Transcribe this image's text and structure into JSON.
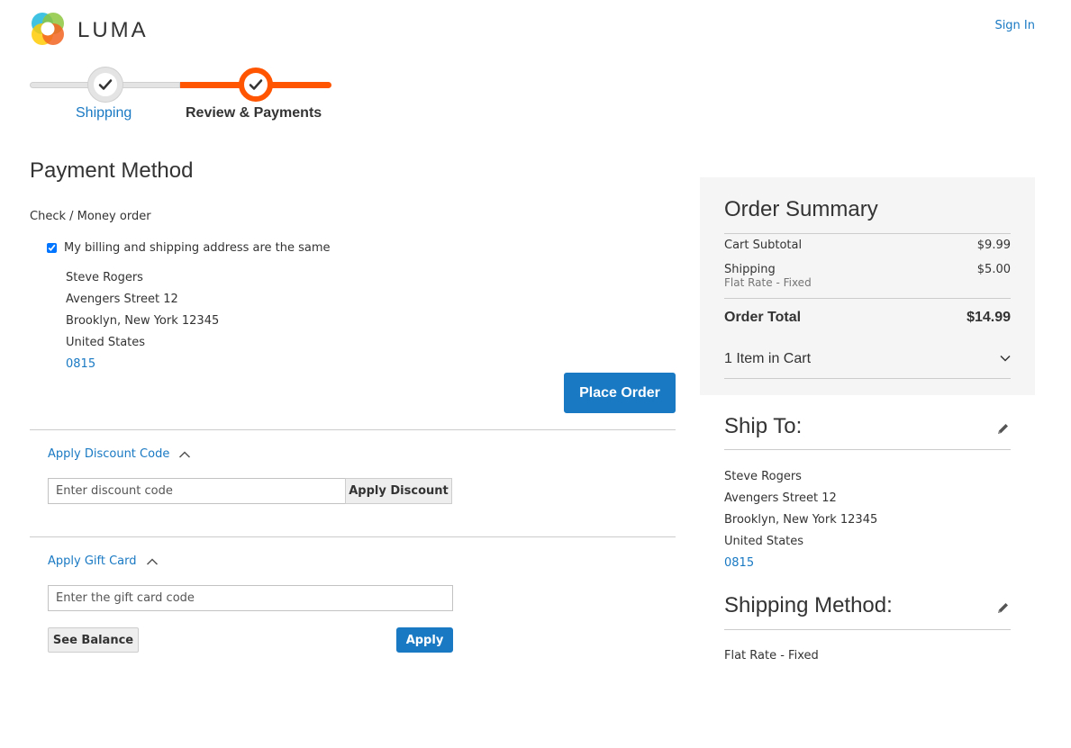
{
  "header": {
    "logo_text": "LUMA",
    "sign_in": "Sign In"
  },
  "progress": {
    "steps": [
      {
        "label": "Shipping",
        "state": "complete"
      },
      {
        "label": "Review & Payments",
        "state": "active"
      }
    ]
  },
  "payment": {
    "title": "Payment Method",
    "method": "Check / Money order",
    "same_address_label": "My billing and shipping address are the same",
    "same_address_checked": true,
    "address": {
      "name": "Steve Rogers",
      "street": "Avengers Street 12",
      "city": "Brooklyn, New York 12345",
      "country": "United States",
      "phone": "0815"
    },
    "place_order": "Place Order"
  },
  "discount": {
    "toggle_label": "Apply Discount Code",
    "placeholder": "Enter discount code",
    "button": "Apply Discount"
  },
  "gift_card": {
    "toggle_label": "Apply Gift Card",
    "placeholder": "Enter the gift card code",
    "see_balance": "See Balance",
    "apply": "Apply"
  },
  "summary": {
    "title": "Order Summary",
    "subtotal_label": "Cart Subtotal",
    "subtotal_value": "$9.99",
    "shipping_label": "Shipping",
    "shipping_value": "$5.00",
    "shipping_method": "Flat Rate - Fixed",
    "total_label": "Order Total",
    "total_value": "$14.99",
    "items_in_cart": "1 Item in Cart"
  },
  "ship_to": {
    "title": "Ship To:",
    "name": "Steve Rogers",
    "street": "Avengers Street 12",
    "city": "Brooklyn, New York 12345",
    "country": "United States",
    "phone": "0815"
  },
  "shipping_method": {
    "title": "Shipping Method:",
    "value": "Flat Rate - Fixed"
  },
  "colors": {
    "accent_blue": "#1979c3",
    "progress_orange": "#ff5501",
    "summary_bg": "#f5f5f5"
  }
}
